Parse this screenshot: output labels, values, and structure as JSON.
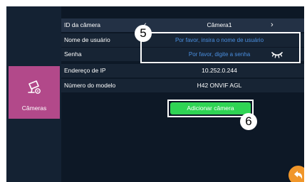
{
  "sidebar": {
    "tile": {
      "label": "Câmeras",
      "icon": "camera-settings-icon"
    }
  },
  "form": {
    "camera_id": {
      "label": "ID da câmera",
      "value": "Câmera1"
    },
    "username": {
      "label": "Nome de usuário",
      "placeholder": "Por favor, insira o nome de usuário"
    },
    "password": {
      "label": "Senha",
      "placeholder": "Por favor, digite a senha",
      "toggle_icon": "eye-closed-icon"
    },
    "ip_address": {
      "label": "Endereço de IP",
      "value": "10.252.0.244"
    },
    "model_number": {
      "label": "Número do modelo",
      "value": "H42 ONVIF AGL"
    }
  },
  "actions": {
    "add_camera_label": "Adicionar câmera",
    "back_icon": "back-arrow-icon"
  },
  "callouts": {
    "first": "5",
    "second": "6"
  },
  "colors": {
    "background": "#0d1826",
    "tile": "#b2498a",
    "placeholder": "#4a8fe0",
    "add_button": "#2fd454",
    "back_button": "#f0962a"
  }
}
